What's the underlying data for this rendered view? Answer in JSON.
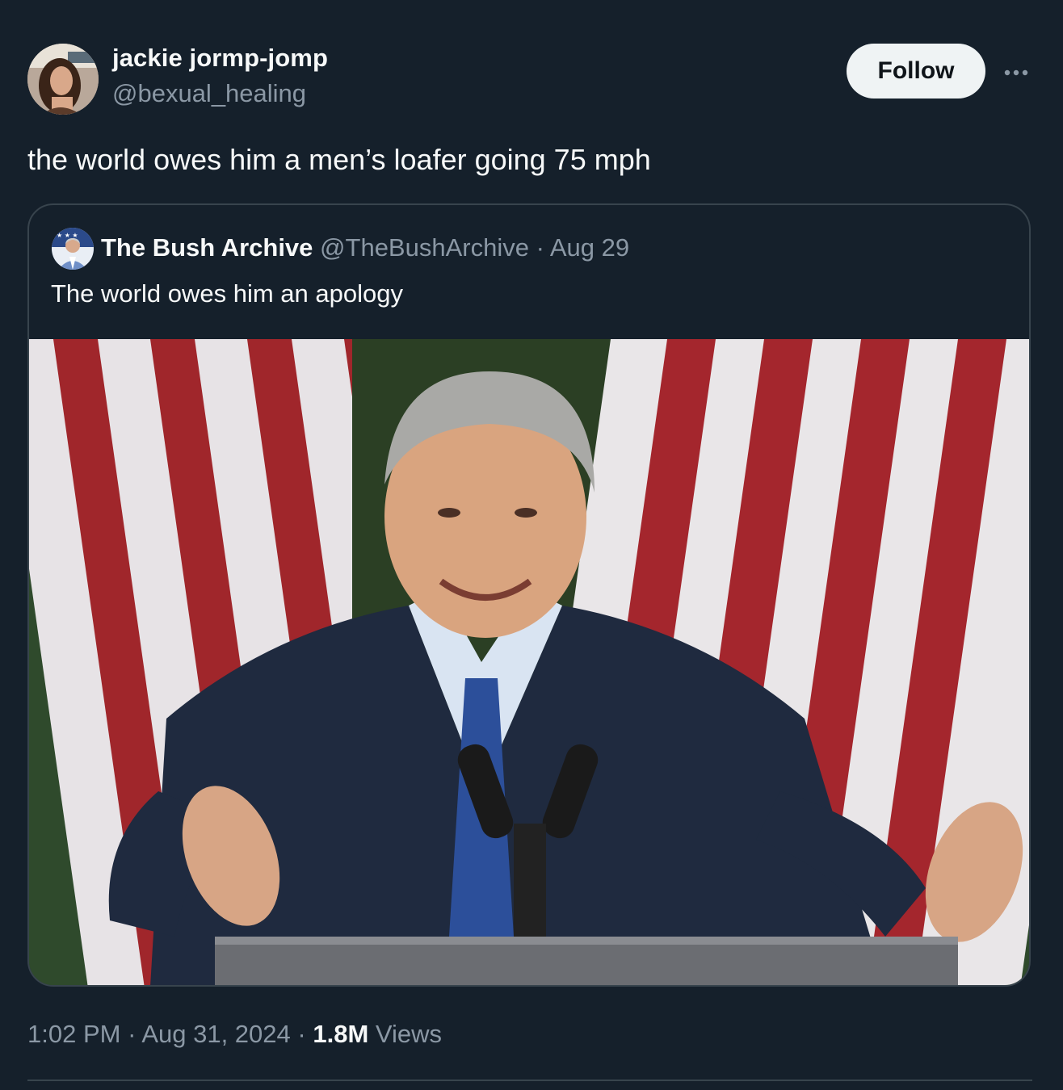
{
  "author": {
    "display_name": "jackie jormp-jomp",
    "handle": "@bexual_healing"
  },
  "follow_label": "Follow",
  "more_icon": "more-horizontal-icon",
  "tweet_text": "the world owes him a men’s loafer going 75 mph",
  "quoted_tweet": {
    "display_name": "The Bush Archive",
    "handle": "@TheBushArchive",
    "separator": "·",
    "date": "Aug 29",
    "text": "The world owes him an apology"
  },
  "meta": {
    "time": "1:02 PM",
    "separator": "·",
    "date": "Aug 31, 2024",
    "views_count": "1.8M",
    "views_label": "Views"
  },
  "colors": {
    "background": "#15202b",
    "text_primary": "#f7f9f9",
    "text_secondary": "#8b98a5",
    "border": "#38444d",
    "follow_button_bg": "#eff3f4"
  }
}
